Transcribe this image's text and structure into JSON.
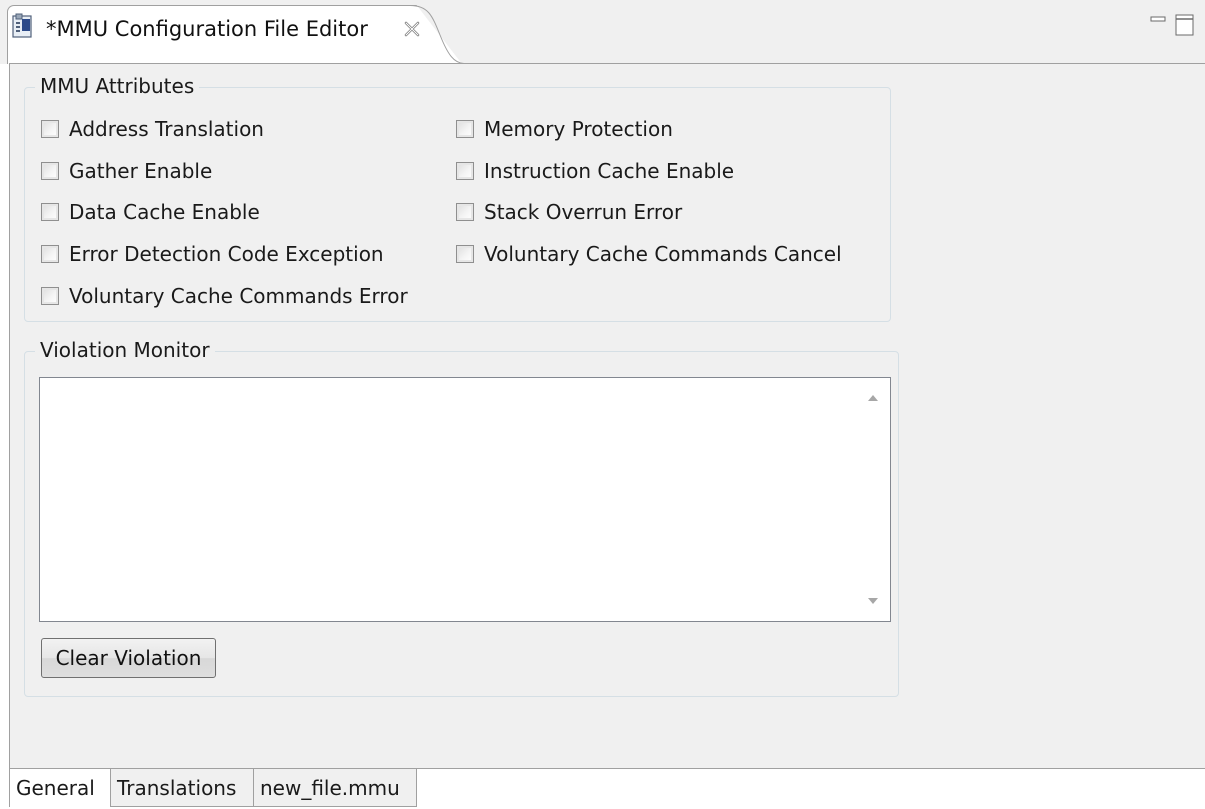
{
  "editor_tab": {
    "title": "*MMU Configuration File Editor",
    "icon": "mmu-file-icon",
    "close_icon": "close-x-icon"
  },
  "window_controls": {
    "minimize_icon": "minimize-icon",
    "maximize_icon": "maximize-icon"
  },
  "mmu_attributes": {
    "title": "MMU Attributes",
    "left_column": [
      {
        "label": "Address Translation",
        "checked": false
      },
      {
        "label": "Gather Enable",
        "checked": false
      },
      {
        "label": "Data Cache Enable",
        "checked": false
      },
      {
        "label": "Error Detection Code Exception",
        "checked": false
      },
      {
        "label": "Voluntary Cache Commands Error",
        "checked": false
      }
    ],
    "right_column": [
      {
        "label": "Memory Protection",
        "checked": false
      },
      {
        "label": "Instruction Cache Enable",
        "checked": false
      },
      {
        "label": "Stack Overrun Error",
        "checked": false
      },
      {
        "label": "Voluntary Cache Commands Cancel",
        "checked": false
      }
    ]
  },
  "violation_monitor": {
    "title": "Violation Monitor",
    "content": "",
    "clear_button_label": "Clear Violation"
  },
  "bottom_tabs": [
    {
      "label": "General",
      "active": true
    },
    {
      "label": "Translations",
      "active": false
    },
    {
      "label": "new_file.mmu",
      "active": false
    }
  ]
}
